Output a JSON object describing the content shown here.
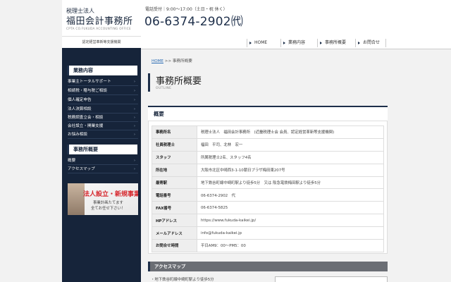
{
  "logo": {
    "line1": "税理士法人",
    "line2": "福田会計事務所",
    "line3": "CPTA CO.FUKUDA ACCOUNTING OFFICE",
    "sub": "認定経営革新等支援機関"
  },
  "header": {
    "hours": "電話受付｜9:00～17:00（土日・祝 休く）",
    "phone": "06-6374-2902㈹"
  },
  "nav": [
    {
      "label": "HOME"
    },
    {
      "label": "業務内容"
    },
    {
      "label": "事務所概要"
    },
    {
      "label": "お問合せ"
    }
  ],
  "sidebar": {
    "section1": {
      "title": "業務内容",
      "items": [
        "事業主トータルサポート",
        "相続税・贈与税ご相談",
        "個人確定申告",
        "法人決算相談",
        "税務調査立会・相談",
        "会社設立・開業支援",
        "お悩み相談"
      ]
    },
    "section2": {
      "title": "事務所概要",
      "items": [
        "概要",
        "アクセスマップ"
      ]
    },
    "banner": {
      "t1": "法人設立・新規事業",
      "t2": "事業計画たてます",
      "t3": "全てお任せ下さい！"
    }
  },
  "breadcrumb": {
    "home": "HOME",
    "sep": " >> ",
    "current": "事務所概要"
  },
  "page": {
    "title": "事務所概要",
    "title_en": "OUTLINE"
  },
  "panel": {
    "heading": "概要",
    "rows": [
      {
        "k": "事務所名",
        "v": "税理士法人　福田会計事務所　(近畿税理士会 会員、認定経営革新等支援機関)"
      },
      {
        "k": "社員税理士",
        "v": "福田　平司、北林　宏一"
      },
      {
        "k": "スタッフ",
        "v": "所属税理士2名、スタッフ4名"
      },
      {
        "k": "所在地",
        "v": "大阪市北区中崎西3-1-10朝日プラザ梅田東207号"
      },
      {
        "k": "最寄駅",
        "v": "地下鉄谷町線中崎町駅より徒歩5分　又は 阪急電鉄梅田駅より徒歩5分"
      },
      {
        "k": "電話番号",
        "v": "06-6374-2902　代"
      },
      {
        "k": "FAX番号",
        "v": "06-6374-5825"
      },
      {
        "k": "HPアドレス",
        "v": "https://www.fukuda-kaikei.jp/"
      },
      {
        "k": "メールアドレス",
        "v": "info@fukuda-kaikei.jp"
      },
      {
        "k": "お問合せ時間",
        "v": "平日AM9：00〜PM5：00"
      }
    ]
  },
  "access": {
    "heading": "アクセスマップ",
    "line": "・地下鉄谷町線中崎町駅より徒歩5分"
  }
}
